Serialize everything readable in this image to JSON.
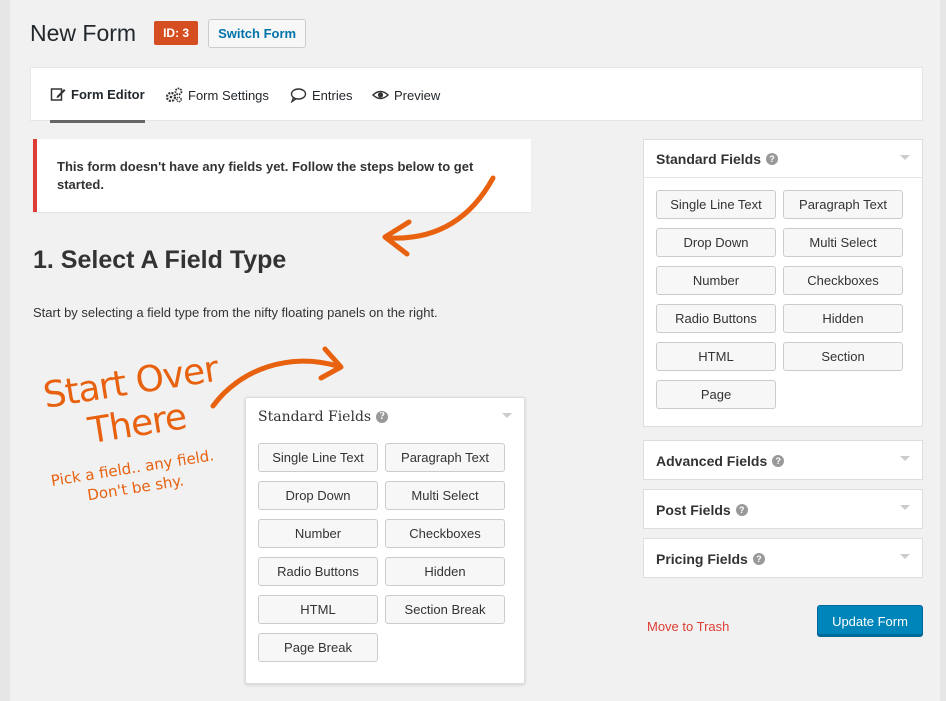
{
  "header": {
    "title": "New Form",
    "id_badge": "ID: 3",
    "switch_label": "Switch Form"
  },
  "tabs": [
    {
      "label": "Form Editor",
      "icon": "pencil-icon",
      "active": true
    },
    {
      "label": "Form Settings",
      "icon": "gears-icon",
      "active": false
    },
    {
      "label": "Entries",
      "icon": "speech-bubble-icon",
      "active": false
    },
    {
      "label": "Preview",
      "icon": "eye-icon",
      "active": false
    }
  ],
  "notice": {
    "text": "This form doesn't have any fields yet. Follow the steps below to get started."
  },
  "instructions": {
    "step_title": "1. Select A Field Type",
    "step_desc": "Start by selecting a field type from the nifty floating panels on the right.",
    "hand_line1": "Start Over",
    "hand_line2": "There",
    "hand_sub1": "Pick a field.. any field.",
    "hand_sub2": "Don't be shy."
  },
  "demo_panel": {
    "title": "Standard Fields",
    "fields": [
      "Single Line Text",
      "Paragraph Text",
      "Drop Down",
      "Multi Select",
      "Number",
      "Checkboxes",
      "Radio Buttons",
      "Hidden",
      "HTML",
      "Section Break",
      "Page Break"
    ]
  },
  "sidebar": {
    "standard": {
      "title": "Standard Fields",
      "fields": [
        "Single Line Text",
        "Paragraph Text",
        "Drop Down",
        "Multi Select",
        "Number",
        "Checkboxes",
        "Radio Buttons",
        "Hidden",
        "HTML",
        "Section",
        "Page"
      ]
    },
    "advanced_title": "Advanced Fields",
    "post_title": "Post Fields",
    "pricing_title": "Pricing Fields"
  },
  "actions": {
    "trash_label": "Move to Trash",
    "update_label": "Update Form"
  },
  "colors": {
    "accent_blue": "#0085ba",
    "badge_orange": "#d54e21",
    "hand_orange": "#e8610f",
    "notice_red": "#dd3d36"
  }
}
